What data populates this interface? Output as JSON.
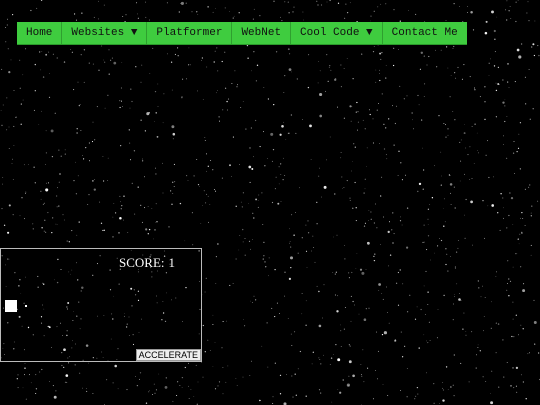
{
  "nav": {
    "items": [
      {
        "label": "Home"
      },
      {
        "label": "Websites ▼"
      },
      {
        "label": "Platformer"
      },
      {
        "label": "WebNet"
      },
      {
        "label": "Cool Code ▼"
      },
      {
        "label": "Contact Me"
      }
    ]
  },
  "game": {
    "score_label": "SCORE:",
    "score_value": "1",
    "accelerate_label": "ACCELERATE"
  },
  "colors": {
    "nav_background": "#3fcc3f",
    "page_background": "#000000",
    "stars": "#ffffff"
  }
}
